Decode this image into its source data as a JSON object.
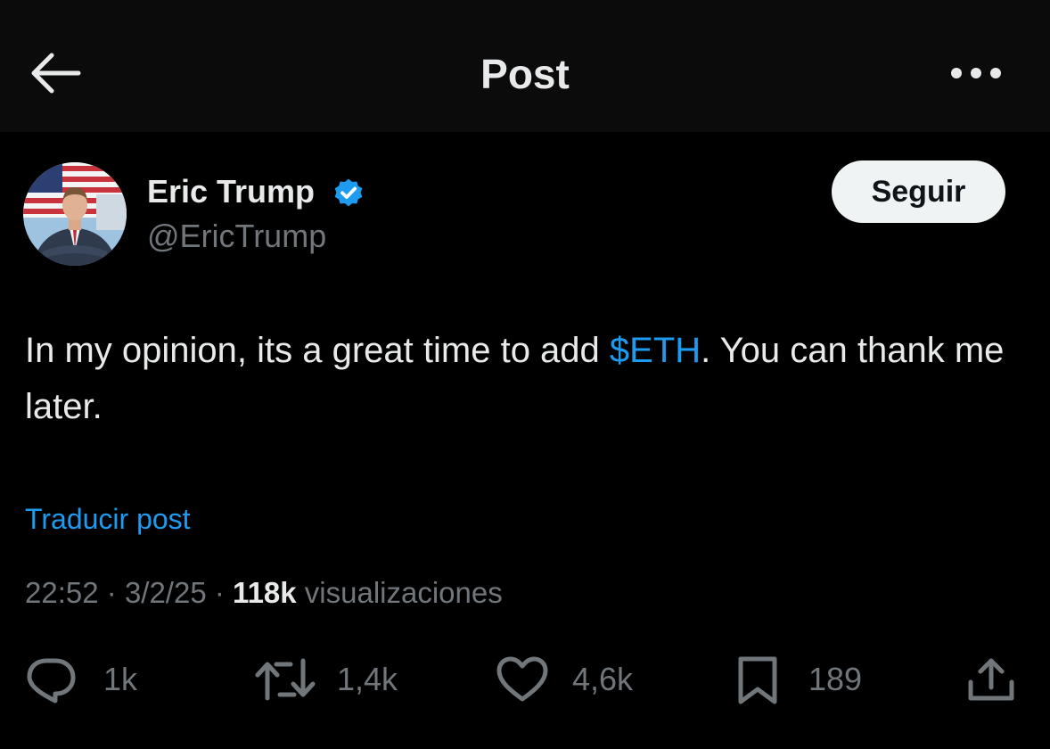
{
  "header": {
    "title": "Post",
    "back_icon": "arrow-left-icon",
    "more_icon": "more-horizontal-icon"
  },
  "author": {
    "name": "Eric Trump",
    "handle": "@EricTrump",
    "verified": true,
    "verified_color": "#1d9bf0",
    "follow_label": "Seguir"
  },
  "post": {
    "text_before": "In my opinion, its a great time to add ",
    "cashtag": "$ETH",
    "text_after": ". You can thank me later.",
    "translate_label": "Traducir post"
  },
  "meta": {
    "time": "22:52",
    "separator": "·",
    "date": "3/2/25",
    "views_count": "118k",
    "views_label": "visualizaciones"
  },
  "actions": {
    "replies": "1k",
    "reposts": "1,4k",
    "likes": "4,6k",
    "bookmarks": "189"
  },
  "colors": {
    "background": "#000000",
    "header_background": "#0b0b0b",
    "text_primary": "#e7e9ea",
    "text_secondary": "#71767b",
    "accent": "#1d9bf0",
    "follow_button": "#eff3f4"
  }
}
